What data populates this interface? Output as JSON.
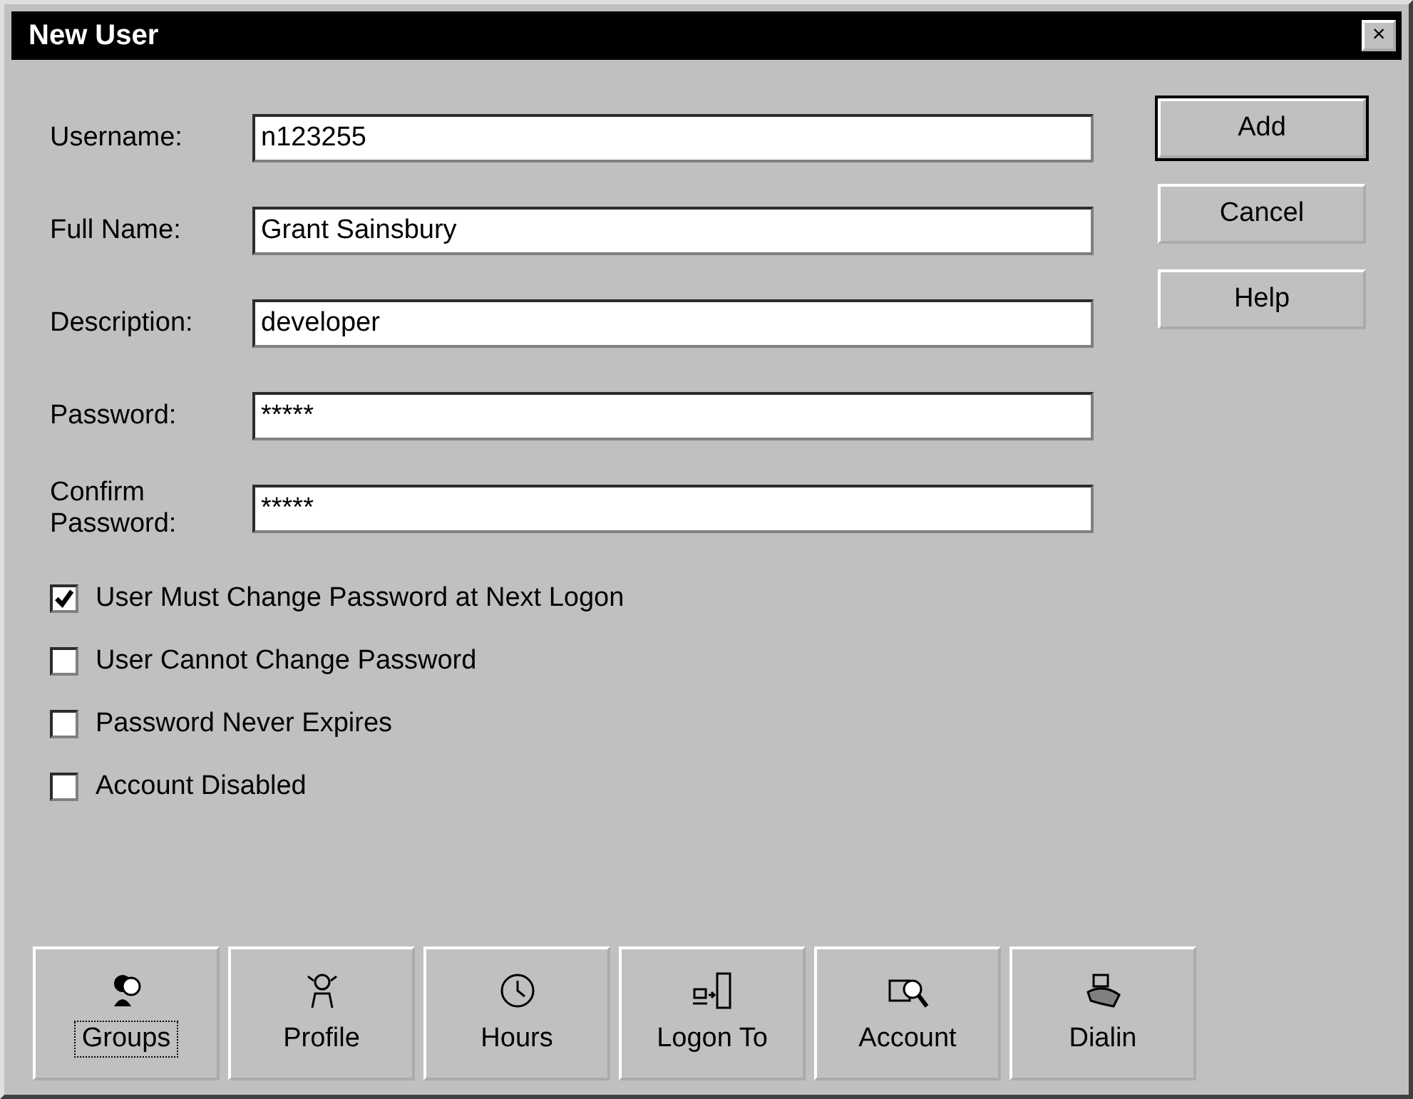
{
  "window": {
    "title": "New User",
    "close_label": "×"
  },
  "fields": [
    {
      "label": "Username:",
      "value": "n123255"
    },
    {
      "label": "Full Name:",
      "value": "Grant Sainsbury"
    },
    {
      "label": "Description:",
      "value": "developer"
    },
    {
      "label": "Password:",
      "value": "*****"
    },
    {
      "label": "Confirm Password:",
      "value": "*****"
    }
  ],
  "buttons": [
    {
      "label": "Add",
      "default": true
    },
    {
      "label": "Cancel",
      "default": false
    },
    {
      "label": "Help",
      "default": false
    }
  ],
  "options": [
    {
      "label": "User Must Change Password at Next Logon",
      "checked": true
    },
    {
      "label": "User Cannot Change Password",
      "checked": false
    },
    {
      "label": "Password Never Expires",
      "checked": false
    },
    {
      "label": "Account Disabled",
      "checked": false
    }
  ],
  "tool_buttons": [
    {
      "label": "Groups",
      "kind": "groups",
      "focused": true
    },
    {
      "label": "Profile",
      "kind": "profile",
      "focused": false
    },
    {
      "label": "Hours",
      "kind": "hours",
      "focused": false
    },
    {
      "label": "Logon To",
      "kind": "logon",
      "focused": false
    },
    {
      "label": "Account",
      "kind": "account",
      "focused": false
    },
    {
      "label": "Dialin",
      "kind": "dialin",
      "focused": false
    }
  ]
}
